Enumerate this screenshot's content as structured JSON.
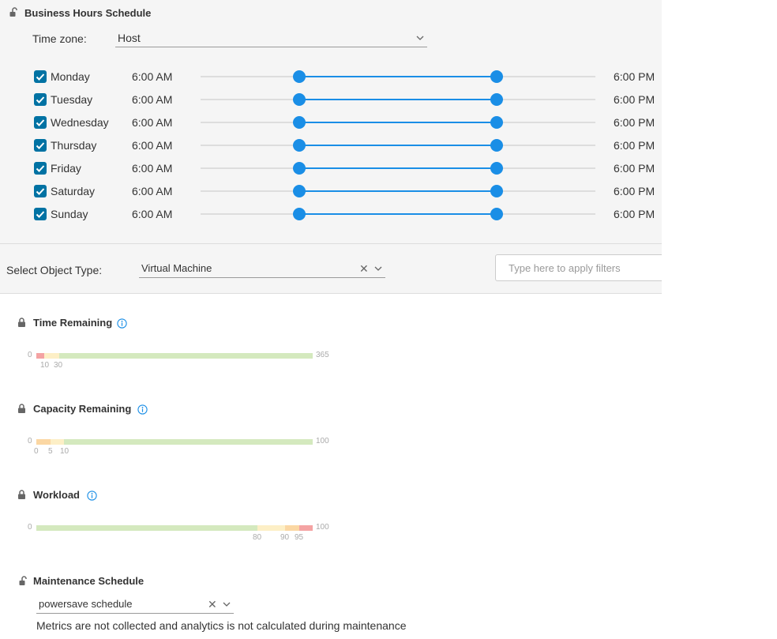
{
  "business_hours": {
    "title": "Business Hours Schedule",
    "timezone_label": "Time zone:",
    "timezone_value": "Host",
    "days": [
      {
        "name": "Monday",
        "enabled": true,
        "start": "6:00 AM",
        "end": "6:00 PM"
      },
      {
        "name": "Tuesday",
        "enabled": true,
        "start": "6:00 AM",
        "end": "6:00 PM"
      },
      {
        "name": "Wednesday",
        "enabled": true,
        "start": "6:00 AM",
        "end": "6:00 PM"
      },
      {
        "name": "Thursday",
        "enabled": true,
        "start": "6:00 AM",
        "end": "6:00 PM"
      },
      {
        "name": "Friday",
        "enabled": true,
        "start": "6:00 AM",
        "end": "6:00 PM"
      },
      {
        "name": "Saturday",
        "enabled": true,
        "start": "6:00 AM",
        "end": "6:00 PM"
      },
      {
        "name": "Sunday",
        "enabled": true,
        "start": "6:00 AM",
        "end": "6:00 PM"
      }
    ],
    "slider_range_fraction": [
      0.25,
      0.75
    ]
  },
  "object_type": {
    "label": "Select Object Type:",
    "value": "Virtual Machine",
    "filter_placeholder": "Type here to apply filters"
  },
  "colors": {
    "accent": "#1a8ee6",
    "checkbox": "#0072a3",
    "critical": "#f4a3a3",
    "warning": "#fbd7a3",
    "immediate": "#fdefc6",
    "normal": "#d4e9be"
  },
  "thresholds": [
    {
      "title": "Time Remaining",
      "min_label": "0",
      "max_label": "365",
      "max": 365,
      "segments": [
        {
          "from": 0,
          "to": 10,
          "level": "critical"
        },
        {
          "from": 10,
          "to": 30,
          "level": "immediate"
        },
        {
          "from": 30,
          "to": 365,
          "level": "normal"
        }
      ],
      "ticks": [
        {
          "value": 10,
          "label": "10"
        },
        {
          "value": 30,
          "label": "30"
        }
      ]
    },
    {
      "title": "Capacity Remaining",
      "min_label": "0",
      "max_label": "100",
      "max": 100,
      "segments": [
        {
          "from": 0,
          "to": 5,
          "level": "warning"
        },
        {
          "from": 5,
          "to": 10,
          "level": "immediate"
        },
        {
          "from": 10,
          "to": 100,
          "level": "normal"
        }
      ],
      "ticks": [
        {
          "value": 0,
          "label": "0"
        },
        {
          "value": 5,
          "label": "5"
        },
        {
          "value": 10,
          "label": "10"
        }
      ]
    },
    {
      "title": "Workload",
      "min_label": "0",
      "max_label": "100",
      "max": 100,
      "segments": [
        {
          "from": 0,
          "to": 80,
          "level": "normal"
        },
        {
          "from": 80,
          "to": 90,
          "level": "immediate"
        },
        {
          "from": 90,
          "to": 95,
          "level": "warning"
        },
        {
          "from": 95,
          "to": 100,
          "level": "critical"
        }
      ],
      "ticks": [
        {
          "value": 80,
          "label": "80"
        },
        {
          "value": 90,
          "label": "90"
        },
        {
          "value": 95,
          "label": "95"
        }
      ]
    }
  ],
  "maintenance": {
    "title": "Maintenance Schedule",
    "value": "powersave schedule",
    "note": "Metrics are not collected and analytics is not calculated during maintenance"
  }
}
